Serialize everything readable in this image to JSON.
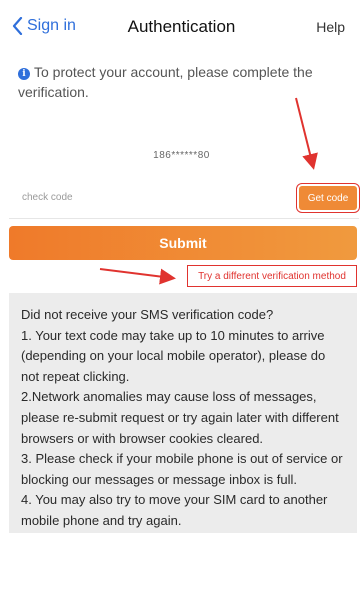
{
  "nav": {
    "back_label": "Sign in",
    "title": "Authentication",
    "help_label": "Help"
  },
  "info": {
    "message": "To protect your account, please complete the verification."
  },
  "phone": {
    "masked_number": "186******80"
  },
  "code": {
    "placeholder": "check code",
    "get_code_label": "Get code"
  },
  "submit_label": "Submit",
  "alt_method_label": "Try a different verification method",
  "notice": {
    "lines": [
      "Did not receive your SMS verification code?",
      "1. Your text code may take up to 10 minutes to arrive (depending on your local mobile operator), please do not repeat clicking.",
      "2.Network anomalies may cause loss of messages, please re-submit request or try again later with different browsers or with browser cookies cleared.",
      "3. Please check if your mobile phone is out of service or blocking our messages or message inbox is full.",
      "4. You may also try to move your SIM card to another mobile phone and try again."
    ]
  },
  "colors": {
    "accent": "#ef8a36",
    "link_blue": "#2f6fdb",
    "annotation_red": "#e0332f"
  }
}
